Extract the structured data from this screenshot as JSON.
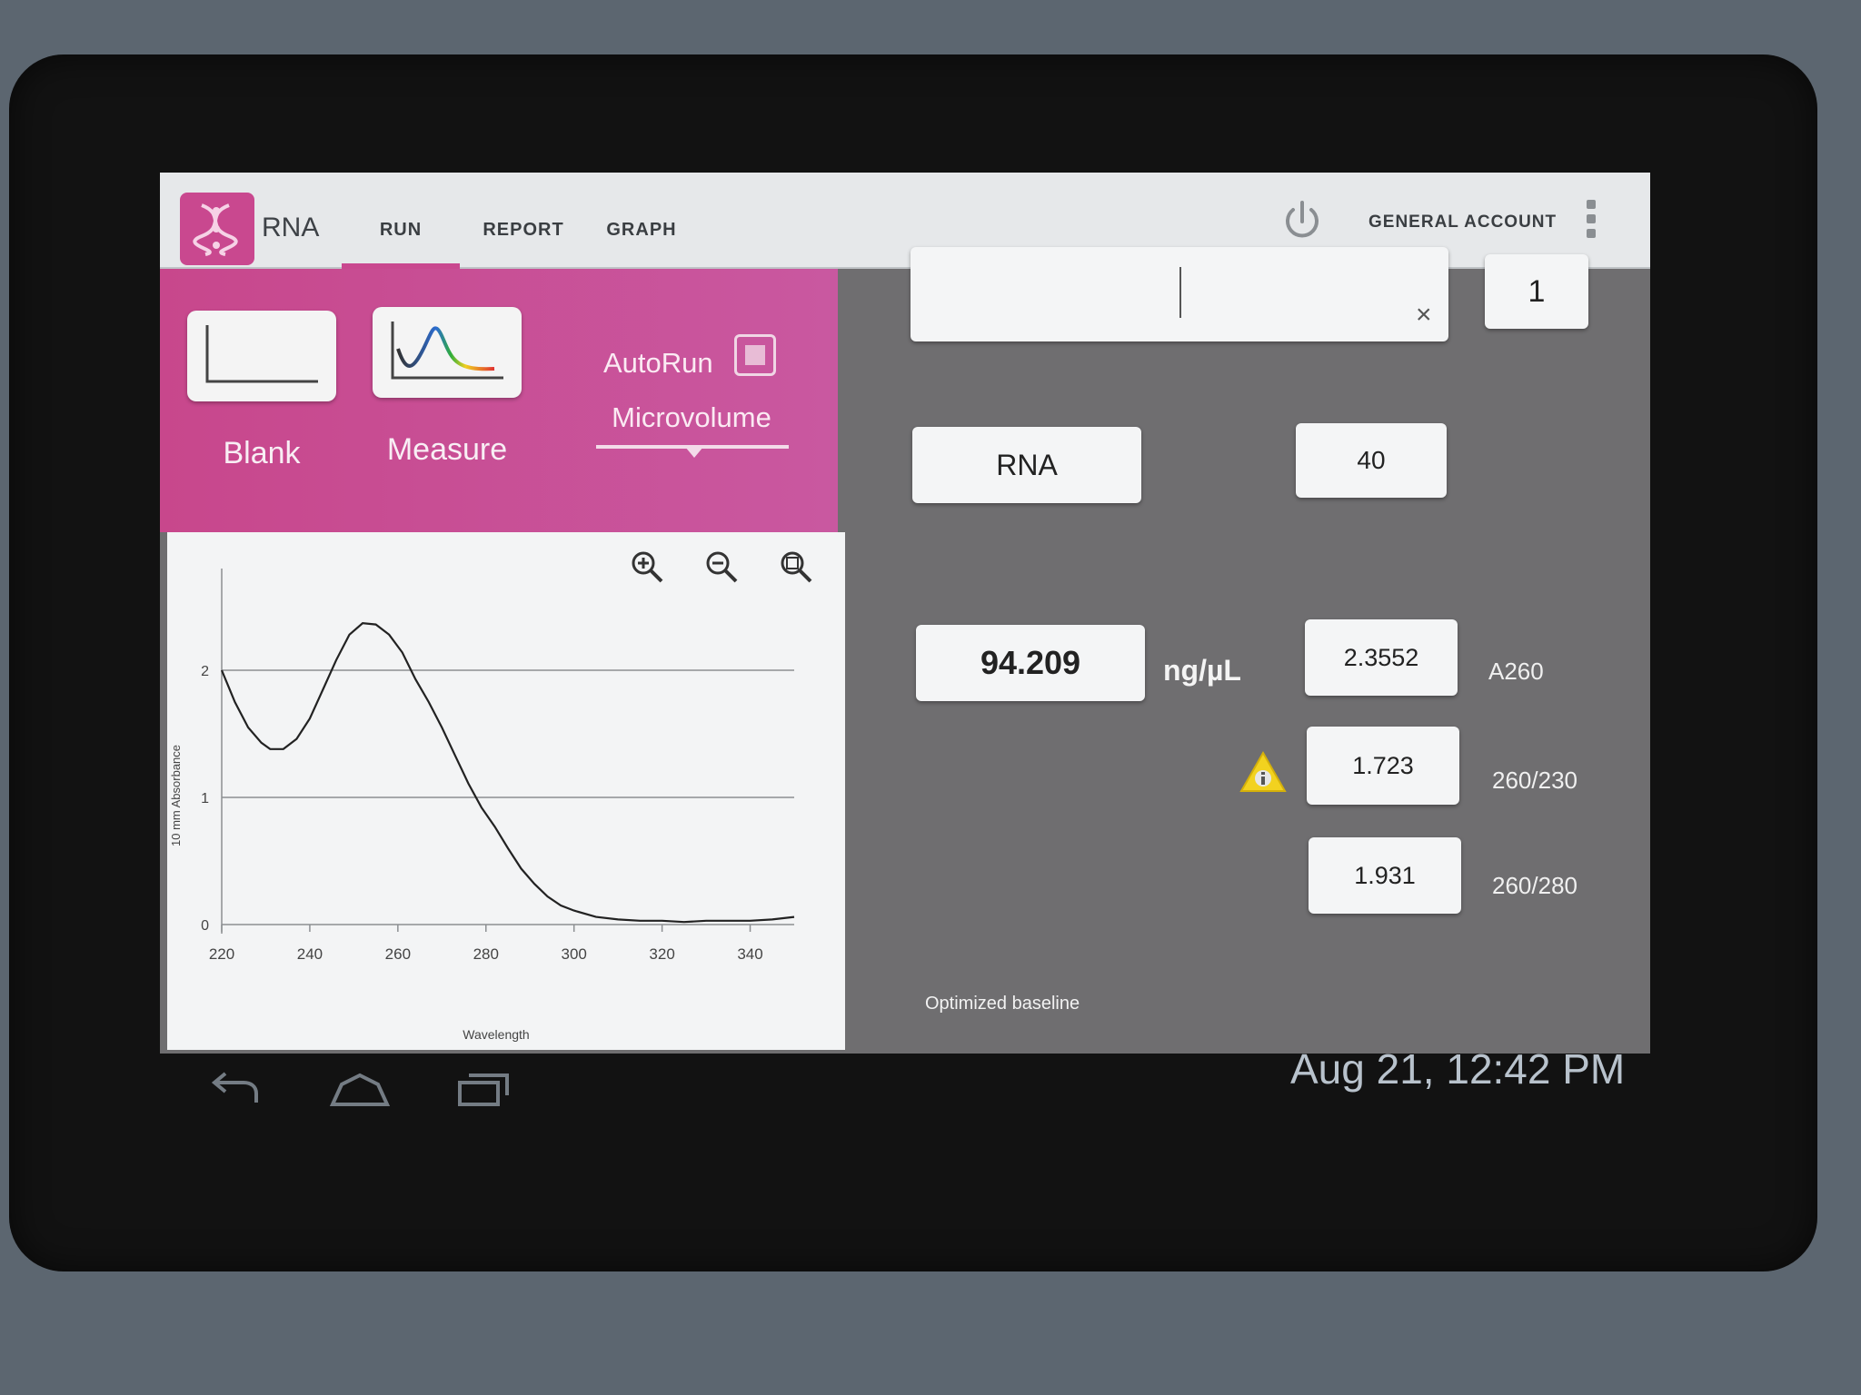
{
  "app": {
    "title": "RNA",
    "tabs": [
      {
        "label": "RUN",
        "active": true
      },
      {
        "label": "REPORT",
        "active": false
      },
      {
        "label": "GRAPH",
        "active": false
      }
    ],
    "account_label": "GENERAL ACCOUNT",
    "accent_color": "#c9488f"
  },
  "controls": {
    "blank_label": "Blank",
    "measure_label": "Measure",
    "autorun_label": "AutoRun",
    "autorun_checked": false,
    "mode": "Microvolume"
  },
  "results": {
    "sample_name": "",
    "sample_number": "1",
    "sample_type": "RNA",
    "factor": "40",
    "concentration": "94.209",
    "concentration_unit": "ng/µL",
    "a260_value": "2.3552",
    "a260_label": "A260",
    "ratio_260_230_value": "1.723",
    "ratio_260_230_label": "260/230",
    "ratio_260_280_value": "1.931",
    "ratio_260_280_label": "260/280",
    "baseline_note": "Optimized baseline"
  },
  "status_bar": {
    "datetime": "Aug 21, 12:42 PM"
  },
  "chart_data": {
    "type": "line",
    "xlabel": "Wavelength",
    "ylabel": "10 mm Absorbance",
    "xlim": [
      220,
      350
    ],
    "ylim": [
      0,
      2.8
    ],
    "x_ticks": [
      "220",
      "240",
      "260",
      "280",
      "300",
      "320",
      "340"
    ],
    "y_ticks": [
      "0",
      "1",
      "2"
    ],
    "gridlines_y": [
      0,
      1,
      2
    ],
    "series": [
      {
        "x": [
          220,
          223,
          226,
          229,
          231,
          234,
          237,
          240,
          243,
          246,
          249,
          252,
          255,
          258,
          261,
          264,
          267,
          270,
          273,
          276,
          279,
          282,
          285,
          288,
          291,
          294,
          297,
          300,
          305,
          310,
          315,
          320,
          325,
          330,
          335,
          340,
          345,
          350
        ],
        "y": [
          2.0,
          1.75,
          1.55,
          1.43,
          1.38,
          1.38,
          1.46,
          1.62,
          1.85,
          2.08,
          2.28,
          2.37,
          2.36,
          2.28,
          2.14,
          1.93,
          1.75,
          1.55,
          1.33,
          1.11,
          0.92,
          0.77,
          0.6,
          0.44,
          0.32,
          0.22,
          0.15,
          0.11,
          0.06,
          0.04,
          0.03,
          0.03,
          0.02,
          0.03,
          0.03,
          0.03,
          0.04,
          0.06
        ]
      }
    ]
  }
}
